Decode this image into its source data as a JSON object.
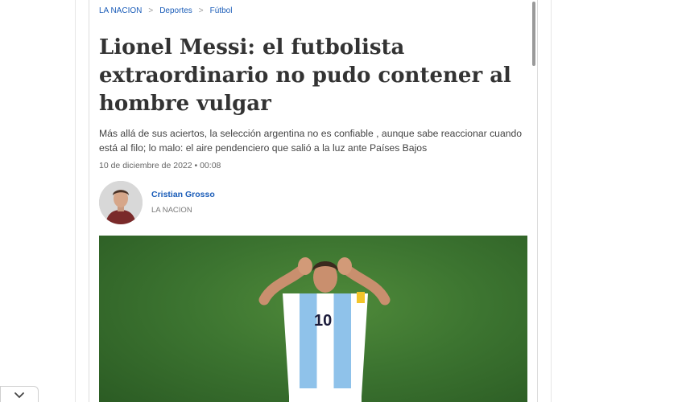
{
  "breadcrumb": {
    "items": [
      "LA NACION",
      "Deportes",
      "Fútbol"
    ],
    "separator": ">"
  },
  "article": {
    "headline_line1": "Lionel Messi: el futbolista",
    "headline_line2": "extraordinario no pudo contener al",
    "headline_line3": "hombre vulgar",
    "dek_line1": "Más allá de sus aciertos, la selección argentina no es confiable , aunque sabe reaccionar cuando",
    "dek_line2": "está al filo; lo malo: el aire pendenciero que salió a la luz ante Países Bajos",
    "dateline": "10 de diciembre de 2022 • 00:08"
  },
  "author": {
    "name": "Cristian Grosso",
    "outlet": "LA NACION"
  },
  "icons": {
    "collapse": "chevron-down-icon"
  },
  "colors": {
    "link_blue": "#1a5cb8",
    "headline": "#333333",
    "pitch_green": "#3c7430"
  }
}
